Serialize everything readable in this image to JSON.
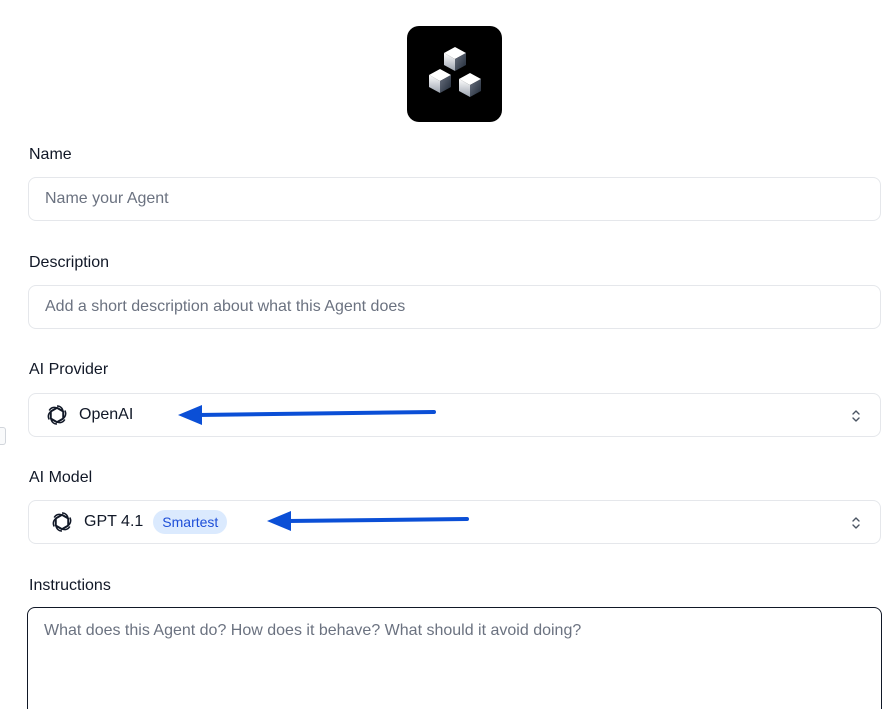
{
  "form": {
    "name_label": "Name",
    "name_placeholder": "Name your Agent",
    "description_label": "Description",
    "description_placeholder": "Add a short description about what this Agent does",
    "provider_label": "AI Provider",
    "provider_value": "OpenAI",
    "provider_icon": "openai-icon",
    "model_label": "AI Model",
    "model_value": "GPT 4.1",
    "model_badge": "Smartest",
    "model_icon": "openai-icon",
    "instructions_label": "Instructions",
    "instructions_placeholder": "What does this Agent do? How does it behave? What should it avoid doing?"
  },
  "colors": {
    "annotation_arrow": "#0b4fd6",
    "badge_bg": "#dbeafe",
    "badge_text": "#1d4ed8",
    "logo_bg": "#000000"
  },
  "icons": {
    "logo": "cubes-logo-icon",
    "select_chevron": "chevron-up-down-icon"
  }
}
